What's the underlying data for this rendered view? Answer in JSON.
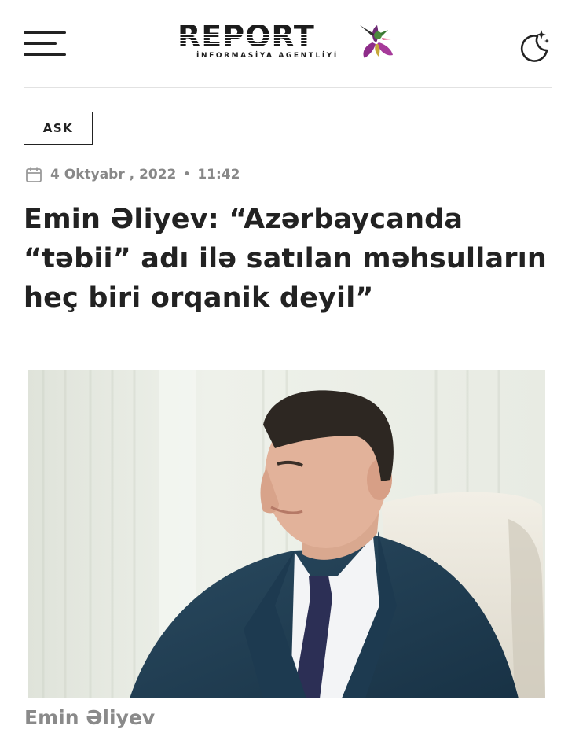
{
  "header": {
    "menu_icon": "hamburger-menu-icon",
    "logo_text": "REPORT",
    "logo_subtitle": "İNFORMASİYA AGENTLİYİ",
    "logo_mark_icon": "hummingbird-flower-icon",
    "theme_icon": "moon-stars-icon"
  },
  "article": {
    "category": "ASK",
    "calendar_icon": "calendar-icon",
    "date": "4 Oktyabr , 2022",
    "separator": "•",
    "time": "11:42",
    "title": "Emin Əliyev: “Azərbaycanda “təbii” adı ilə satılan məhsulların heç biri orqanik deyil”",
    "photo_caption": "Emin Əliyev"
  },
  "colors": {
    "text": "#222222",
    "meta": "#888888",
    "suit": "#1f3a4d",
    "tie": "#2c2f55",
    "background": "#ffffff"
  }
}
